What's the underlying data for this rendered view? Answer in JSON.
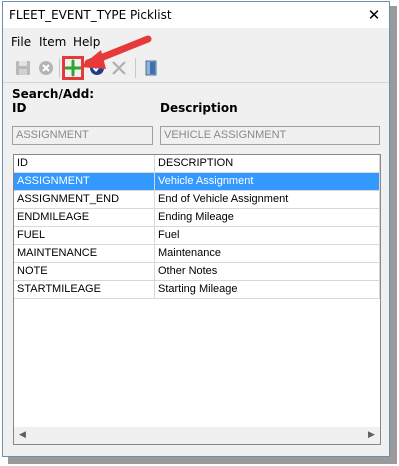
{
  "window": {
    "title": "FLEET_EVENT_TYPE Picklist",
    "close_label": "✕"
  },
  "menu": [
    {
      "label": "File"
    },
    {
      "label": "Item"
    },
    {
      "label": "Help"
    }
  ],
  "toolbar": {
    "icons": [
      "save-icon",
      "cancel-icon",
      "add-icon",
      "check-icon",
      "delete-icon",
      "exit-icon"
    ],
    "colors": {
      "add": "#2fa52f",
      "highlight": "#e63a3a",
      "check": "#1f3c8f"
    }
  },
  "search": {
    "heading": "Search/Add:",
    "id_label": "ID",
    "description_label": "Description",
    "id_value": "ASSIGNMENT",
    "description_value": "VEHICLE ASSIGNMENT"
  },
  "grid": {
    "columns": [
      "ID",
      "DESCRIPTION"
    ],
    "rows": [
      [
        "ASSIGNMENT",
        "Vehicle Assignment"
      ],
      [
        "ASSIGNMENT_END",
        "End of Vehicle Assignment"
      ],
      [
        "ENDMILEAGE",
        "Ending Mileage"
      ],
      [
        "FUEL",
        "Fuel"
      ],
      [
        "MAINTENANCE",
        "Maintenance"
      ],
      [
        "NOTE",
        "Other Notes"
      ],
      [
        "STARTMILEAGE",
        "Starting Mileage"
      ]
    ],
    "selected_row": 0,
    "selection_color": "#3399ff"
  }
}
